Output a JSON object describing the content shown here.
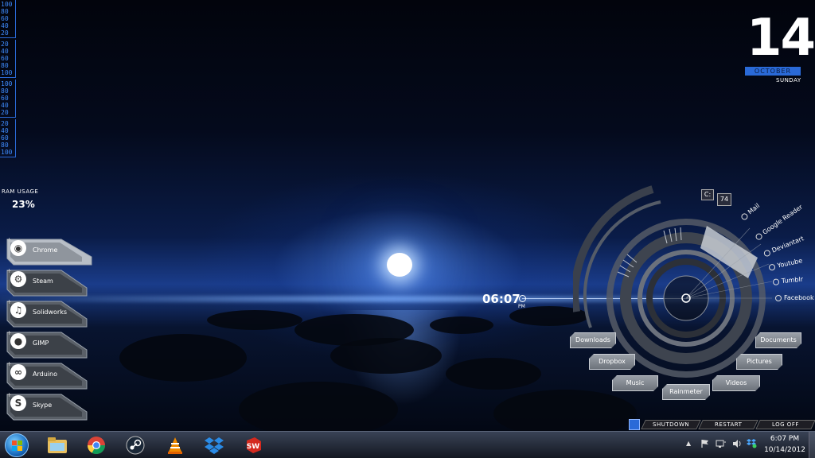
{
  "cpu_meter": {
    "blocks": [
      [
        "100",
        "80",
        "60",
        "40",
        "20"
      ],
      [
        "20",
        "40",
        "60",
        "80",
        "100"
      ],
      [
        "100",
        "80",
        "60",
        "40",
        "20"
      ],
      [
        "20",
        "40",
        "60",
        "80",
        "100"
      ]
    ]
  },
  "ram": {
    "label": "RAM USAGE",
    "value": "23%"
  },
  "launchers": [
    {
      "label": "Chrome",
      "icon": "chrome-icon",
      "glyph": "◉"
    },
    {
      "label": "Steam",
      "icon": "steam-icon",
      "glyph": "⚙"
    },
    {
      "label": "Solidworks",
      "icon": "music-note-icon",
      "glyph": "♫"
    },
    {
      "label": "GIMP",
      "icon": "gimp-icon",
      "glyph": "●"
    },
    {
      "label": "Arduino",
      "icon": "arduino-icon",
      "glyph": "∞"
    },
    {
      "label": "Skype",
      "icon": "skype-icon",
      "glyph": "S"
    }
  ],
  "date": {
    "day": "14",
    "month": "OCTOBER",
    "weekday": "SUNDAY"
  },
  "clock": {
    "time": "06:07",
    "ampm": "PM"
  },
  "drive": {
    "letter": "C:",
    "value": "74"
  },
  "web_links": [
    "Mail",
    "Google Reader",
    "Deviantart",
    "Youtube",
    "Tumblr",
    "Facebook"
  ],
  "folders": {
    "downloads": "Downloads",
    "dropbox": "Dropbox",
    "music": "Music",
    "rainmeter": "Rainmeter",
    "videos": "Videos",
    "pictures": "Pictures",
    "documents": "Documents"
  },
  "power": {
    "shutdown": "SHUTDOWN",
    "restart": "RESTART",
    "logoff": "LOG OFF"
  },
  "taskbar": {
    "apps": [
      "explorer-icon",
      "chrome-icon",
      "steam-icon",
      "vlc-icon",
      "dropbox-icon",
      "solidworks-icon"
    ],
    "solidworks_label": "SW"
  },
  "tray": {
    "time": "6:07 PM",
    "date": "10/14/2012"
  },
  "colors": {
    "accent": "#2a6ad8",
    "meter": "#3f8cff"
  }
}
